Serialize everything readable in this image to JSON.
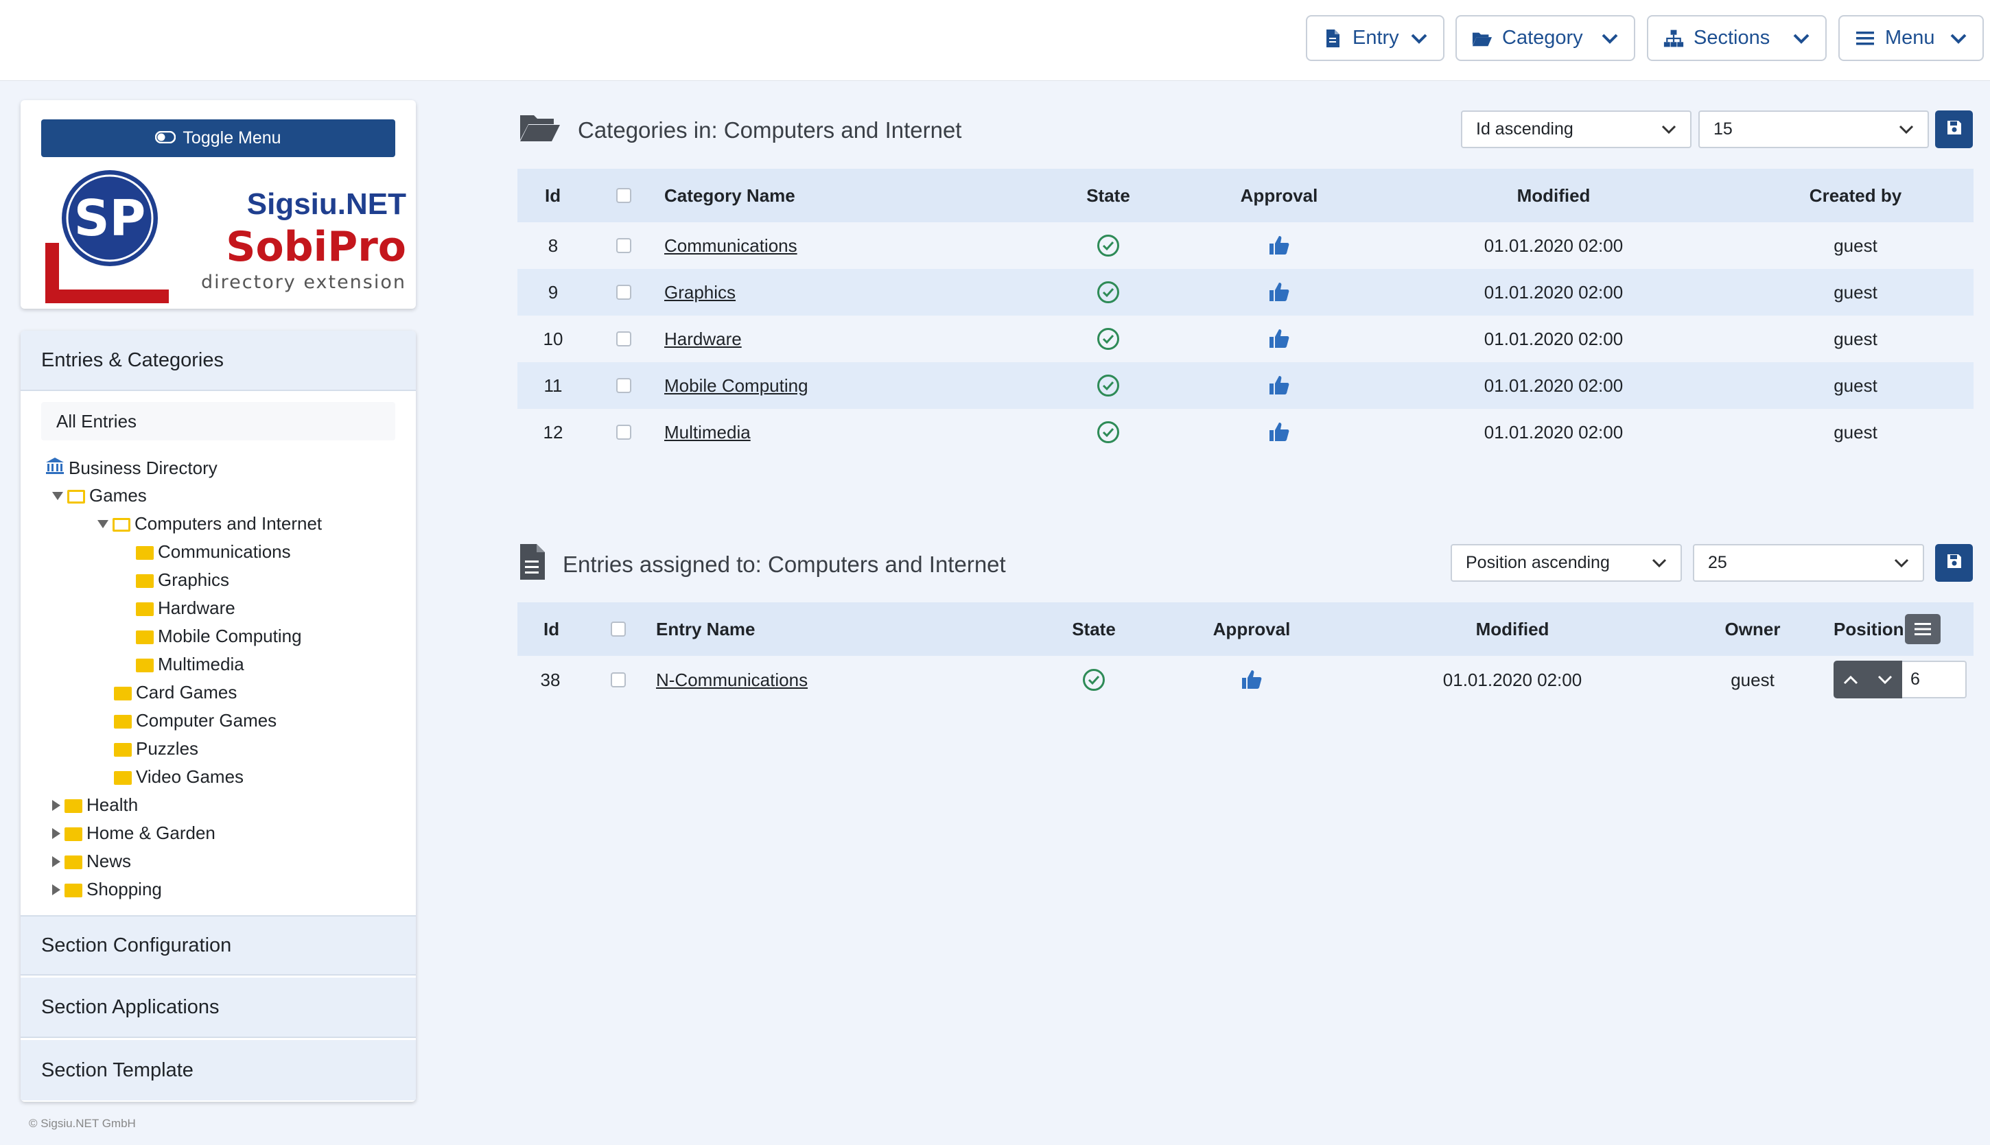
{
  "topbar": {
    "buttons": [
      {
        "label": "Entry",
        "icon": "file-icon"
      },
      {
        "label": "Category",
        "icon": "folder-open-icon"
      },
      {
        "label": "Sections",
        "icon": "sitemap-icon"
      },
      {
        "label": "Menu",
        "icon": "bars-icon"
      }
    ]
  },
  "sidebar": {
    "toggle_label": "Toggle Menu",
    "logo": {
      "brand": "Sigsiu.NET",
      "product": "SobiPro",
      "tagline": "directory extension",
      "monogram": "SP"
    },
    "accordion_main": "Entries & Categories",
    "all_entries": "All Entries",
    "tree": [
      {
        "label": "Business Directory"
      },
      {
        "label": "Games"
      },
      {
        "label": "Computers and Internet"
      },
      {
        "label": "Communications"
      },
      {
        "label": "Graphics"
      },
      {
        "label": "Hardware"
      },
      {
        "label": "Mobile Computing"
      },
      {
        "label": "Multimedia"
      },
      {
        "label": "Card Games"
      },
      {
        "label": "Computer Games"
      },
      {
        "label": "Puzzles"
      },
      {
        "label": "Video Games"
      },
      {
        "label": "Health"
      },
      {
        "label": "Home & Garden"
      },
      {
        "label": "News"
      },
      {
        "label": "Shopping"
      }
    ],
    "sections": [
      "Section Configuration",
      "Section Applications",
      "Section Template"
    ],
    "copyright": "© Sigsiu.NET GmbH"
  },
  "categories": {
    "title": "Categories in: Computers and Internet",
    "order_select": "Id ascending",
    "limit_select": "15",
    "columns": [
      "Id",
      "Category Name",
      "State",
      "Approval",
      "Modified",
      "Created by"
    ],
    "rows": [
      {
        "id": "8",
        "name": "Communications",
        "modified": "01.01.2020 02:00",
        "created_by": "guest"
      },
      {
        "id": "9",
        "name": "Graphics",
        "modified": "01.01.2020 02:00",
        "created_by": "guest"
      },
      {
        "id": "10",
        "name": "Hardware",
        "modified": "01.01.2020 02:00",
        "created_by": "guest"
      },
      {
        "id": "11",
        "name": "Mobile Computing",
        "modified": "01.01.2020 02:00",
        "created_by": "guest"
      },
      {
        "id": "12",
        "name": "Multimedia",
        "modified": "01.01.2020 02:00",
        "created_by": "guest"
      }
    ]
  },
  "entries": {
    "title": "Entries assigned to: Computers and Internet",
    "order_select": "Position ascending",
    "limit_select": "25",
    "columns": [
      "Id",
      "Entry Name",
      "State",
      "Approval",
      "Modified",
      "Owner",
      "Position"
    ],
    "rows": [
      {
        "id": "38",
        "name": "N-Communications",
        "modified": "01.01.2020 02:00",
        "owner": "guest",
        "position": "6"
      }
    ]
  },
  "colors": {
    "accent": "#1e4b87",
    "state_ok": "#2e8b57",
    "approval": "#2f6fbf",
    "folder": "#f5c400"
  }
}
